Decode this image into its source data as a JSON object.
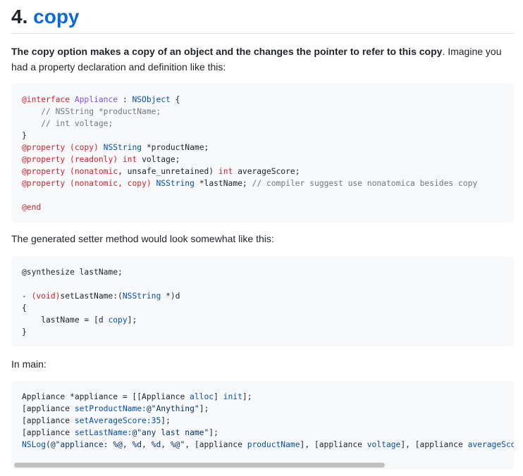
{
  "heading": {
    "number": "4.",
    "link": "copy"
  },
  "intro": {
    "bold": "The copy option makes a copy of an object and the changes the pointer to refer to this copy",
    "rest": ". Imagine you had a property declaration and definition like this:"
  },
  "code1": {
    "l1_kw": "@interface",
    "l1_cls": "Appliance",
    "l1_sep": " : ",
    "l1_base": "NSObject",
    "l1_end": " {",
    "l2": "    // NSString *productName;",
    "l3": "    // int voltage;",
    "l4": "}",
    "l5_kw": "@property",
    "l5_attr": "(copy)",
    "l5_type": "NSString",
    "l5_rest": " *productName;",
    "l6_kw": "@property",
    "l6_attr": "(readonly)",
    "l6_type": "int",
    "l6_rest": " voltage;",
    "l7_kw": "@property",
    "l7_open": "(",
    "l7_attr": "nonatomic",
    "l7_mid": ", unsafe_unretained) ",
    "l7_type": "int",
    "l7_rest": " averageScore;",
    "l8_kw": "@property",
    "l8_open": "(",
    "l8_attr1": "nonatomic",
    "l8_sep": ", ",
    "l8_attr2": "copy",
    "l8_close": ") ",
    "l8_type": "NSString",
    "l8_rest": " *lastName; ",
    "l8_comment": "// compiler suggest use nonatomica besides copy",
    "l9_kw": "@end"
  },
  "para2": "The generated setter method would look somewhat like this:",
  "code2": {
    "l1": "@synthesize lastName;",
    "l2_pre": "- ",
    "l2_kw": "(void)",
    "l2_mid": "setLastName:(",
    "l2_type": "NSString",
    "l2_end": " *)d",
    "l3": "{",
    "l4_pre": "    lastName = [d ",
    "l4_msg": "copy",
    "l4_end": "];",
    "l5": "}"
  },
  "para3": "In main:",
  "code3": {
    "l1_pre": "Appliance *appliance = [[Appliance ",
    "l1_m1": "alloc",
    "l1_mid": "] ",
    "l1_m2": "init",
    "l1_end": "];",
    "l2_pre": "[appliance ",
    "l2_m": "setProductName:",
    "l2_s": "@\"Anything\"",
    "l2_end": "];",
    "l3_pre": "[appliance ",
    "l3_m": "setAverageScore:",
    "l3_n": "35",
    "l3_end": "];",
    "l4_pre": "[appliance ",
    "l4_m": "setLastName:",
    "l4_s": "@\"any last name\"",
    "l4_end": "];",
    "l5_fn": "NSLog",
    "l5_open": "(",
    "l5_s": "@\"appliance: %@, %d, %d, %@\"",
    "l5_a": ", [appliance ",
    "l5_m1": "productName",
    "l5_b": "], [appliance ",
    "l5_m2": "voltage",
    "l5_c": "], [appliance ",
    "l5_m3": "averageScore"
  }
}
